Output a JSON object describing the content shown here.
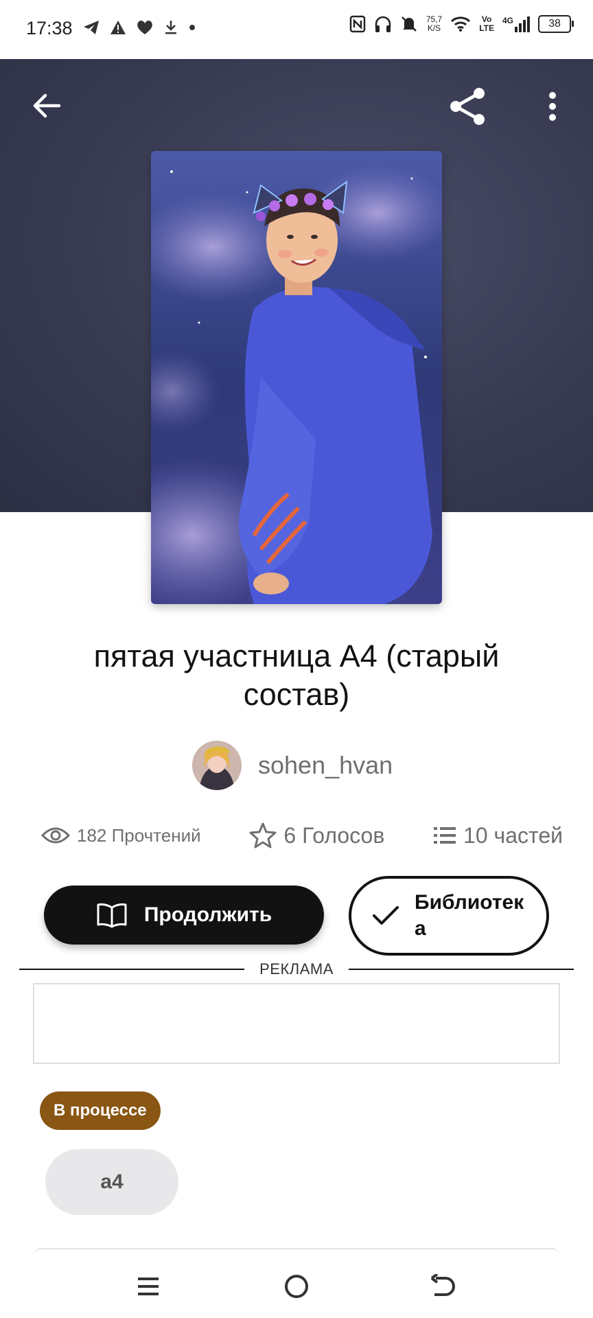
{
  "status_bar": {
    "time": "17:38",
    "speed": "75,7",
    "speed_unit": "K/S",
    "volte_top": "Vo",
    "volte_bottom": "LTE",
    "network": "4G",
    "battery": "38",
    "icons": [
      "telegram-icon",
      "warning-icon",
      "heart-app-icon",
      "download-icon",
      "dot-icon",
      "nfc-icon",
      "headphones-icon",
      "mute-icon",
      "wifi-icon",
      "signal-icon",
      "battery-icon"
    ]
  },
  "header": {
    "back_icon": "arrow-left-icon",
    "share_icon": "share-icon",
    "more_icon": "more-vertical-icon"
  },
  "story": {
    "title": "пятая участница А4 (старый состав)",
    "author": "sohen_hvan",
    "stats": {
      "reads": "182 Прочтений",
      "votes": "6 Голосов",
      "parts": "10 частей"
    },
    "continue_label": "Продолжить",
    "library_label": "Библиотека",
    "status": "В процессе",
    "tags": [
      "а4"
    ]
  },
  "ad": {
    "label": "РЕКЛАМА"
  },
  "colors": {
    "hero_bg": "#383a52",
    "primary_button": "#121212",
    "status_pill": "#8a5613",
    "tag_bg": "#e8e8ea"
  }
}
